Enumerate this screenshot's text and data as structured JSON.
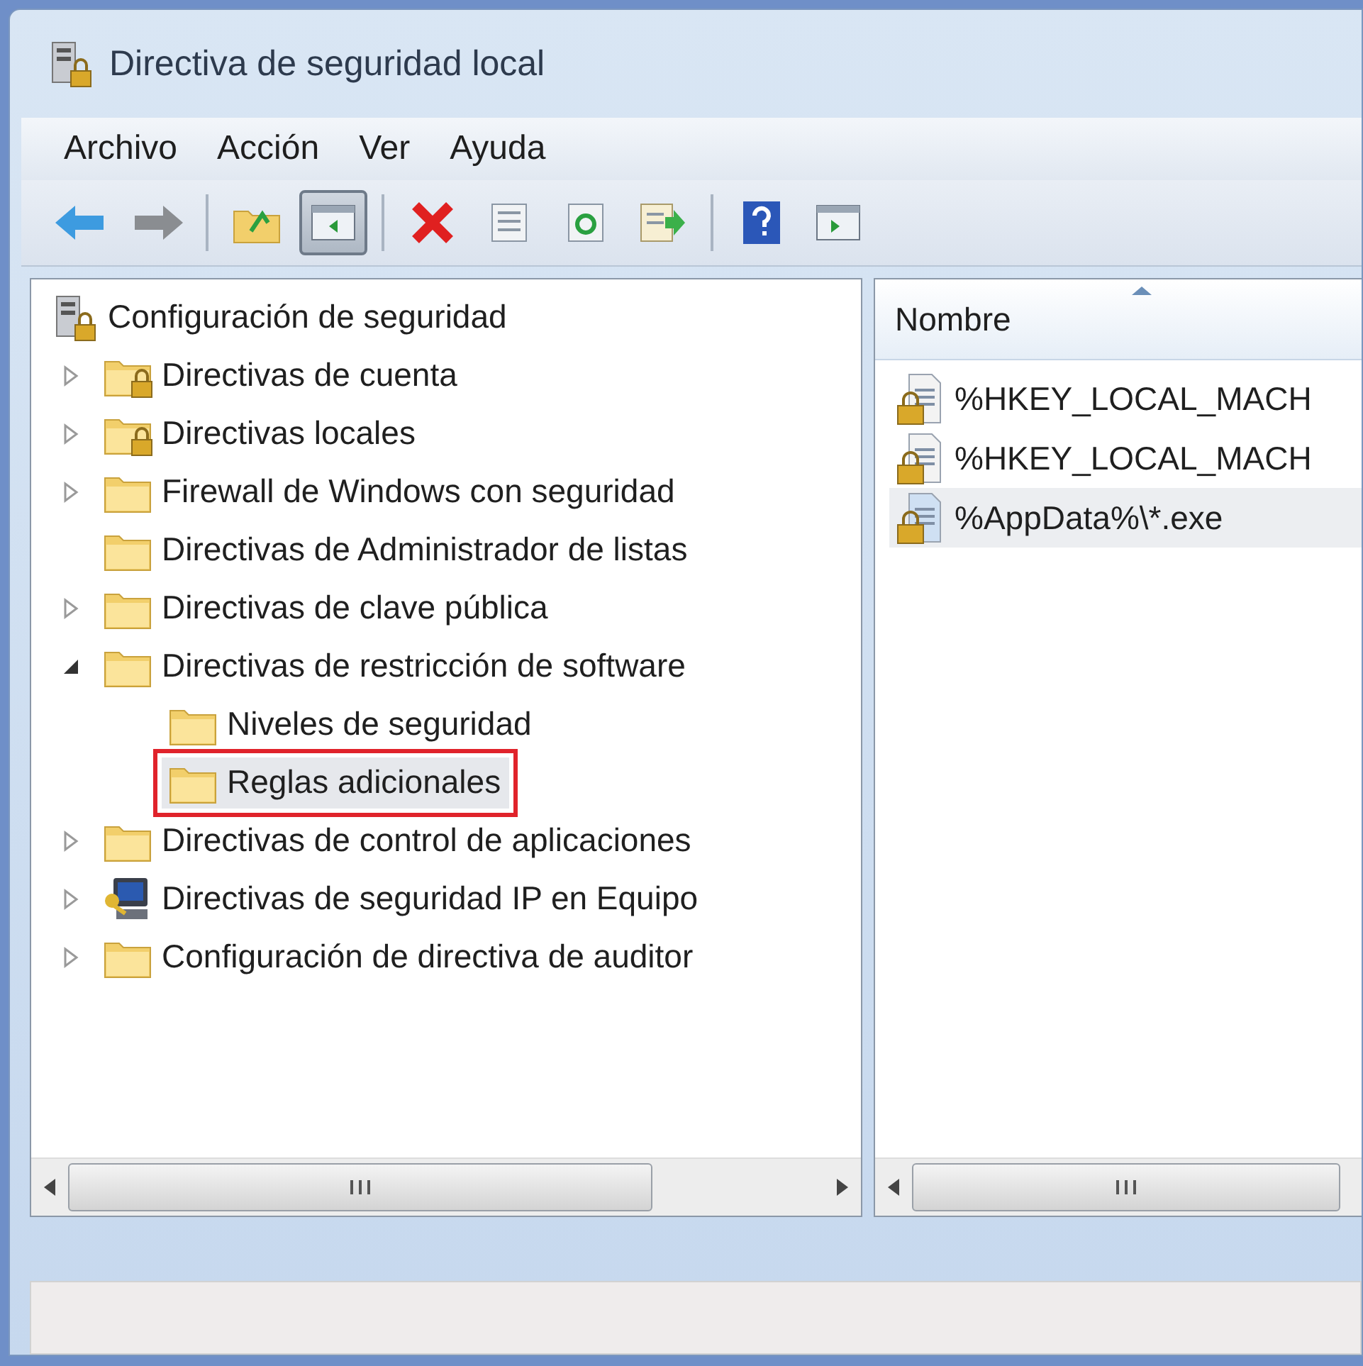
{
  "window": {
    "title": "Directiva de seguridad local"
  },
  "menu": [
    "Archivo",
    "Acción",
    "Ver",
    "Ayuda"
  ],
  "toolbar": [
    {
      "kind": "back",
      "pressed": false
    },
    {
      "kind": "forward",
      "pressed": false
    },
    {
      "kind": "separator"
    },
    {
      "kind": "folder-up",
      "pressed": false
    },
    {
      "kind": "tree-pane",
      "pressed": true
    },
    {
      "kind": "separator"
    },
    {
      "kind": "delete",
      "pressed": false
    },
    {
      "kind": "properties",
      "pressed": false
    },
    {
      "kind": "refresh",
      "pressed": false
    },
    {
      "kind": "export",
      "pressed": false
    },
    {
      "kind": "separator"
    },
    {
      "kind": "help",
      "pressed": false
    },
    {
      "kind": "action-pane",
      "pressed": false
    }
  ],
  "tree": {
    "label": "Configuración de seguridad",
    "kind": "root",
    "children": [
      {
        "label": "Directivas de cuenta",
        "kind": "lock-folder",
        "expanded": false,
        "selected": false
      },
      {
        "label": "Directivas locales",
        "kind": "lock-folder",
        "expanded": false,
        "selected": false
      },
      {
        "label": "Firewall de Windows con seguridad",
        "kind": "folder",
        "expanded": false,
        "selected": false
      },
      {
        "label": "Directivas de Administrador de listas",
        "kind": "folder",
        "selected": false
      },
      {
        "label": "Directivas de clave pública",
        "kind": "folder",
        "expanded": false,
        "selected": false
      },
      {
        "label": "Directivas de restricción de software",
        "kind": "folder",
        "expanded": true,
        "selected": false,
        "children": [
          {
            "label": "Niveles de seguridad",
            "kind": "folder",
            "selected": false
          },
          {
            "label": "Reglas adicionales",
            "kind": "folder",
            "selected": true
          }
        ]
      },
      {
        "label": "Directivas de control de aplicaciones",
        "kind": "folder",
        "expanded": false,
        "selected": false
      },
      {
        "label": "Directivas de seguridad IP en Equipo",
        "kind": "computer",
        "expanded": false,
        "selected": false
      },
      {
        "label": "Configuración de directiva de auditor",
        "kind": "folder",
        "expanded": false,
        "selected": false
      }
    ]
  },
  "list": {
    "column": "Nombre",
    "rows": [
      {
        "name": "%HKEY_LOCAL_MACH",
        "selected": false
      },
      {
        "name": "%HKEY_LOCAL_MACH",
        "selected": false
      },
      {
        "name": "%AppData%\\*.exe",
        "selected": true
      }
    ]
  }
}
